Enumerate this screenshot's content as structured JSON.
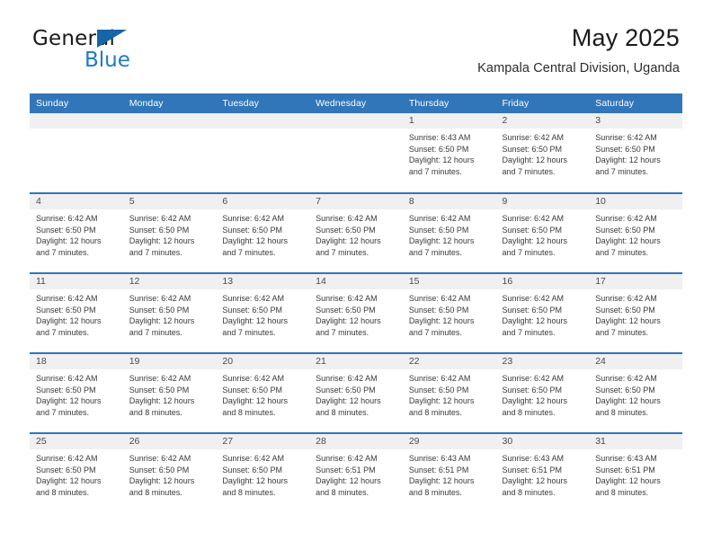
{
  "logo": {
    "word1": "General",
    "word2": "Blue",
    "triangle_color": "#1565a8",
    "word2_color": "#1e7ac4"
  },
  "header": {
    "title": "May 2025",
    "location": "Kampala Central Division, Uganda"
  },
  "theme": {
    "header_blue": "#3176b8",
    "daynum_bg": "#f0f0f0",
    "text": "#3a3a3a"
  },
  "calendar": {
    "weekday_headers": [
      "Sunday",
      "Monday",
      "Tuesday",
      "Wednesday",
      "Thursday",
      "Friday",
      "Saturday"
    ],
    "weeks": [
      [
        {
          "day": "",
          "blank": true,
          "sunrise": "",
          "sunset": "",
          "daylight1": "",
          "daylight2": ""
        },
        {
          "day": "",
          "blank": true,
          "sunrise": "",
          "sunset": "",
          "daylight1": "",
          "daylight2": ""
        },
        {
          "day": "",
          "blank": true,
          "sunrise": "",
          "sunset": "",
          "daylight1": "",
          "daylight2": ""
        },
        {
          "day": "",
          "blank": true,
          "sunrise": "",
          "sunset": "",
          "daylight1": "",
          "daylight2": ""
        },
        {
          "day": "1",
          "sunrise": "Sunrise: 6:43 AM",
          "sunset": "Sunset: 6:50 PM",
          "daylight1": "Daylight: 12 hours",
          "daylight2": "and 7 minutes."
        },
        {
          "day": "2",
          "sunrise": "Sunrise: 6:42 AM",
          "sunset": "Sunset: 6:50 PM",
          "daylight1": "Daylight: 12 hours",
          "daylight2": "and 7 minutes."
        },
        {
          "day": "3",
          "sunrise": "Sunrise: 6:42 AM",
          "sunset": "Sunset: 6:50 PM",
          "daylight1": "Daylight: 12 hours",
          "daylight2": "and 7 minutes."
        }
      ],
      [
        {
          "day": "4",
          "sunrise": "Sunrise: 6:42 AM",
          "sunset": "Sunset: 6:50 PM",
          "daylight1": "Daylight: 12 hours",
          "daylight2": "and 7 minutes."
        },
        {
          "day": "5",
          "sunrise": "Sunrise: 6:42 AM",
          "sunset": "Sunset: 6:50 PM",
          "daylight1": "Daylight: 12 hours",
          "daylight2": "and 7 minutes."
        },
        {
          "day": "6",
          "sunrise": "Sunrise: 6:42 AM",
          "sunset": "Sunset: 6:50 PM",
          "daylight1": "Daylight: 12 hours",
          "daylight2": "and 7 minutes."
        },
        {
          "day": "7",
          "sunrise": "Sunrise: 6:42 AM",
          "sunset": "Sunset: 6:50 PM",
          "daylight1": "Daylight: 12 hours",
          "daylight2": "and 7 minutes."
        },
        {
          "day": "8",
          "sunrise": "Sunrise: 6:42 AM",
          "sunset": "Sunset: 6:50 PM",
          "daylight1": "Daylight: 12 hours",
          "daylight2": "and 7 minutes."
        },
        {
          "day": "9",
          "sunrise": "Sunrise: 6:42 AM",
          "sunset": "Sunset: 6:50 PM",
          "daylight1": "Daylight: 12 hours",
          "daylight2": "and 7 minutes."
        },
        {
          "day": "10",
          "sunrise": "Sunrise: 6:42 AM",
          "sunset": "Sunset: 6:50 PM",
          "daylight1": "Daylight: 12 hours",
          "daylight2": "and 7 minutes."
        }
      ],
      [
        {
          "day": "11",
          "sunrise": "Sunrise: 6:42 AM",
          "sunset": "Sunset: 6:50 PM",
          "daylight1": "Daylight: 12 hours",
          "daylight2": "and 7 minutes."
        },
        {
          "day": "12",
          "sunrise": "Sunrise: 6:42 AM",
          "sunset": "Sunset: 6:50 PM",
          "daylight1": "Daylight: 12 hours",
          "daylight2": "and 7 minutes."
        },
        {
          "day": "13",
          "sunrise": "Sunrise: 6:42 AM",
          "sunset": "Sunset: 6:50 PM",
          "daylight1": "Daylight: 12 hours",
          "daylight2": "and 7 minutes."
        },
        {
          "day": "14",
          "sunrise": "Sunrise: 6:42 AM",
          "sunset": "Sunset: 6:50 PM",
          "daylight1": "Daylight: 12 hours",
          "daylight2": "and 7 minutes."
        },
        {
          "day": "15",
          "sunrise": "Sunrise: 6:42 AM",
          "sunset": "Sunset: 6:50 PM",
          "daylight1": "Daylight: 12 hours",
          "daylight2": "and 7 minutes."
        },
        {
          "day": "16",
          "sunrise": "Sunrise: 6:42 AM",
          "sunset": "Sunset: 6:50 PM",
          "daylight1": "Daylight: 12 hours",
          "daylight2": "and 7 minutes."
        },
        {
          "day": "17",
          "sunrise": "Sunrise: 6:42 AM",
          "sunset": "Sunset: 6:50 PM",
          "daylight1": "Daylight: 12 hours",
          "daylight2": "and 7 minutes."
        }
      ],
      [
        {
          "day": "18",
          "sunrise": "Sunrise: 6:42 AM",
          "sunset": "Sunset: 6:50 PM",
          "daylight1": "Daylight: 12 hours",
          "daylight2": "and 7 minutes."
        },
        {
          "day": "19",
          "sunrise": "Sunrise: 6:42 AM",
          "sunset": "Sunset: 6:50 PM",
          "daylight1": "Daylight: 12 hours",
          "daylight2": "and 8 minutes."
        },
        {
          "day": "20",
          "sunrise": "Sunrise: 6:42 AM",
          "sunset": "Sunset: 6:50 PM",
          "daylight1": "Daylight: 12 hours",
          "daylight2": "and 8 minutes."
        },
        {
          "day": "21",
          "sunrise": "Sunrise: 6:42 AM",
          "sunset": "Sunset: 6:50 PM",
          "daylight1": "Daylight: 12 hours",
          "daylight2": "and 8 minutes."
        },
        {
          "day": "22",
          "sunrise": "Sunrise: 6:42 AM",
          "sunset": "Sunset: 6:50 PM",
          "daylight1": "Daylight: 12 hours",
          "daylight2": "and 8 minutes."
        },
        {
          "day": "23",
          "sunrise": "Sunrise: 6:42 AM",
          "sunset": "Sunset: 6:50 PM",
          "daylight1": "Daylight: 12 hours",
          "daylight2": "and 8 minutes."
        },
        {
          "day": "24",
          "sunrise": "Sunrise: 6:42 AM",
          "sunset": "Sunset: 6:50 PM",
          "daylight1": "Daylight: 12 hours",
          "daylight2": "and 8 minutes."
        }
      ],
      [
        {
          "day": "25",
          "sunrise": "Sunrise: 6:42 AM",
          "sunset": "Sunset: 6:50 PM",
          "daylight1": "Daylight: 12 hours",
          "daylight2": "and 8 minutes."
        },
        {
          "day": "26",
          "sunrise": "Sunrise: 6:42 AM",
          "sunset": "Sunset: 6:50 PM",
          "daylight1": "Daylight: 12 hours",
          "daylight2": "and 8 minutes."
        },
        {
          "day": "27",
          "sunrise": "Sunrise: 6:42 AM",
          "sunset": "Sunset: 6:50 PM",
          "daylight1": "Daylight: 12 hours",
          "daylight2": "and 8 minutes."
        },
        {
          "day": "28",
          "sunrise": "Sunrise: 6:42 AM",
          "sunset": "Sunset: 6:51 PM",
          "daylight1": "Daylight: 12 hours",
          "daylight2": "and 8 minutes."
        },
        {
          "day": "29",
          "sunrise": "Sunrise: 6:43 AM",
          "sunset": "Sunset: 6:51 PM",
          "daylight1": "Daylight: 12 hours",
          "daylight2": "and 8 minutes."
        },
        {
          "day": "30",
          "sunrise": "Sunrise: 6:43 AM",
          "sunset": "Sunset: 6:51 PM",
          "daylight1": "Daylight: 12 hours",
          "daylight2": "and 8 minutes."
        },
        {
          "day": "31",
          "sunrise": "Sunrise: 6:43 AM",
          "sunset": "Sunset: 6:51 PM",
          "daylight1": "Daylight: 12 hours",
          "daylight2": "and 8 minutes."
        }
      ]
    ]
  }
}
